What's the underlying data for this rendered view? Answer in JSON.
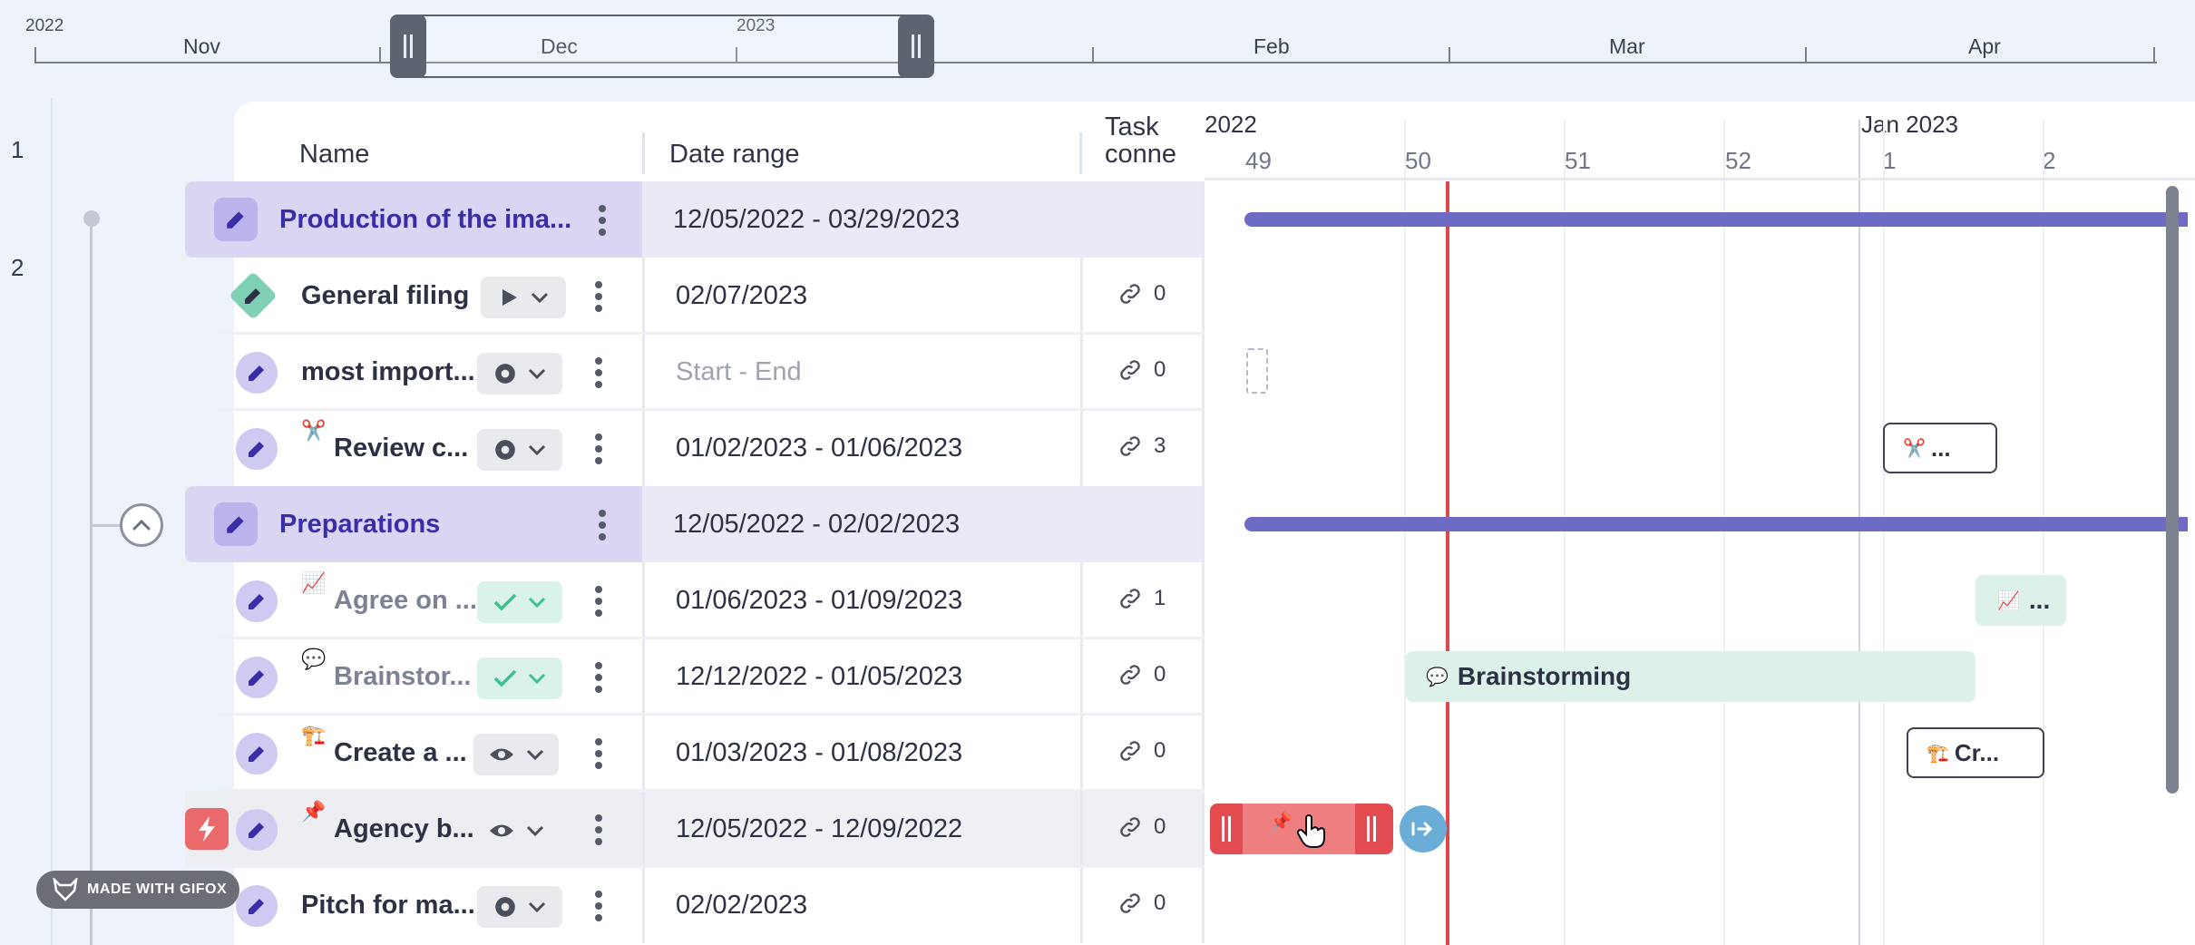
{
  "timeline_nav": {
    "years": [
      "2022",
      "2023"
    ],
    "months": [
      "Nov",
      "Dec",
      "Feb",
      "Mar",
      "Apr"
    ]
  },
  "rail": {
    "row_numbers": [
      "1",
      "2"
    ]
  },
  "table": {
    "headers": {
      "name": "Name",
      "date_range": "Date range",
      "task_conn_line1": "Task",
      "task_conn_line2": "conne"
    },
    "rows": [
      {
        "name": "Production of the ima...",
        "emoji": "",
        "status": "",
        "date_start": "12/05/2022",
        "date_sep": "-",
        "date_end": "03/29/2023",
        "connections": "",
        "group": true
      },
      {
        "name": "General filing",
        "emoji": "",
        "status": "play",
        "date_start": "02/07/2023",
        "date_sep": "",
        "date_end": "",
        "connections": "0"
      },
      {
        "name": "most import...",
        "emoji": "",
        "status": "circle",
        "date_start": "Start",
        "date_sep": "-",
        "date_end": "End",
        "connections": "0"
      },
      {
        "name": "Review c...",
        "emoji": "✂️",
        "status": "circle",
        "date_start": "01/02/2023",
        "date_sep": "-",
        "date_end": "01/06/2023",
        "connections": "3"
      },
      {
        "name": "Preparations",
        "emoji": "",
        "status": "",
        "date_start": "12/05/2022",
        "date_sep": "-",
        "date_end": "02/02/2023",
        "connections": "",
        "group": true
      },
      {
        "name": "Agree on ...",
        "emoji": "📈",
        "status": "done",
        "date_start": "01/06/2023",
        "date_sep": "-",
        "date_end": "01/09/2023",
        "connections": "1"
      },
      {
        "name": "Brainstor...",
        "emoji": "💬",
        "status": "done",
        "date_start": "12/12/2022",
        "date_sep": "-",
        "date_end": "01/05/2023",
        "connections": "0"
      },
      {
        "name": "Create a ...",
        "emoji": "🏗️",
        "status": "eye",
        "date_start": "01/03/2023",
        "date_sep": "-",
        "date_end": "01/08/2023",
        "connections": "0"
      },
      {
        "name": "Agency b...",
        "emoji": "📌",
        "status": "eye",
        "date_start": "12/05/2022",
        "date_sep": "-",
        "date_end": "12/09/2022",
        "connections": "0"
      },
      {
        "name": "Pitch for ma...",
        "emoji": "",
        "status": "circle",
        "date_start": "02/02/2023",
        "date_sep": "",
        "date_end": "",
        "connections": "0"
      }
    ]
  },
  "gantt": {
    "year_labels": [
      "2022",
      "Jan 2023"
    ],
    "weeks": [
      "49",
      "50",
      "51",
      "52",
      "1",
      "2"
    ],
    "bars": {
      "review": {
        "emoji": "✂️",
        "label": "..."
      },
      "agree": {
        "emoji": "📈",
        "label": "..."
      },
      "brainstorm": {
        "emoji": "💬",
        "label": "Brainstorming"
      },
      "create": {
        "emoji": "🏗️",
        "label": "Cr..."
      },
      "agency": {
        "emoji": "📌"
      }
    }
  },
  "watermark": "MADE WITH GIFOX",
  "colors": {
    "accent": "#6f6bc5",
    "today": "#e0464b",
    "done": "#dbf1ea",
    "active": "#e24b4f"
  }
}
